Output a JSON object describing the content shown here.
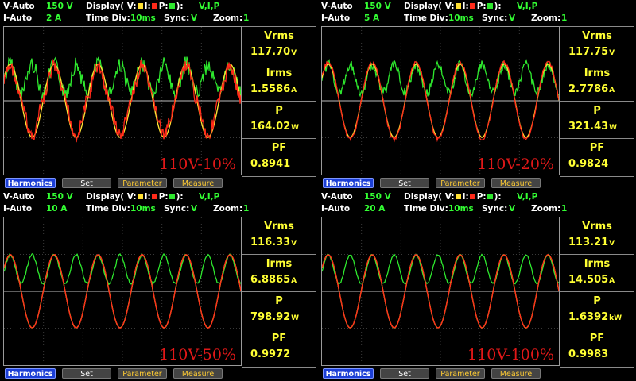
{
  "panels": [
    {
      "v_range_label": "V-Auto",
      "v_range": "150 V",
      "i_range_label": "I-Auto",
      "i_range": "2 A",
      "display_label": "Display( V:",
      "display_i": "I:",
      "display_p": "P:",
      "display_close": "):",
      "display_value": "V,I,P",
      "time_div_label": "Time  Div:",
      "time_div": "10ms",
      "sync_label": "Sync:",
      "sync": "V",
      "zoom_label": "Zoom:",
      "zoom": "1",
      "scenario": "110V-10%",
      "measurements": [
        {
          "label": "Vrms",
          "value": "117.70",
          "unit": "V"
        },
        {
          "label": "Irms",
          "value": "1.5586",
          "unit": "A"
        },
        {
          "label": "P",
          "value": "164.02",
          "unit": "W"
        },
        {
          "label": "PF",
          "value": "0.8941",
          "unit": ""
        }
      ],
      "buttons": {
        "harmonics": "Harmonics",
        "set": "Set",
        "parameter": "Parameter",
        "measure": "Measure"
      }
    },
    {
      "v_range_label": "V-Auto",
      "v_range": "150 V",
      "i_range_label": "I-Auto",
      "i_range": "5 A",
      "display_label": "Display( V:",
      "display_i": "I:",
      "display_p": "P:",
      "display_close": "):",
      "display_value": "V,I,P",
      "time_div_label": "Time  Div:",
      "time_div": "10ms",
      "sync_label": "Sync:",
      "sync": "V",
      "zoom_label": "Zoom:",
      "zoom": "1",
      "scenario": "110V-20%",
      "measurements": [
        {
          "label": "Vrms",
          "value": "117.75",
          "unit": "V"
        },
        {
          "label": "Irms",
          "value": "2.7786",
          "unit": "A"
        },
        {
          "label": "P",
          "value": "321.43",
          "unit": "W"
        },
        {
          "label": "PF",
          "value": "0.9824",
          "unit": ""
        }
      ],
      "buttons": {
        "harmonics": "Harmonics",
        "set": "Set",
        "parameter": "Parameter",
        "measure": "Measure"
      }
    },
    {
      "v_range_label": "V-Auto",
      "v_range": "150 V",
      "i_range_label": "I-Auto",
      "i_range": "10 A",
      "display_label": "Display( V:",
      "display_i": "I:",
      "display_p": "P:",
      "display_close": "):",
      "display_value": "V,I,P",
      "time_div_label": "Time  Div:",
      "time_div": "10ms",
      "sync_label": "Sync:",
      "sync": "V",
      "zoom_label": "Zoom:",
      "zoom": "1",
      "scenario": "110V-50%",
      "measurements": [
        {
          "label": "Vrms",
          "value": "116.33",
          "unit": "V"
        },
        {
          "label": "Irms",
          "value": "6.8865",
          "unit": "A"
        },
        {
          "label": "P",
          "value": "798.92",
          "unit": "W"
        },
        {
          "label": "PF",
          "value": "0.9972",
          "unit": ""
        }
      ],
      "buttons": {
        "harmonics": "Harmonics",
        "set": "Set",
        "parameter": "Parameter",
        "measure": "Measure"
      }
    },
    {
      "v_range_label": "V-Auto",
      "v_range": "150 V",
      "i_range_label": "I-Auto",
      "i_range": "20 A",
      "display_label": "Display( V:",
      "display_i": "I:",
      "display_p": "P:",
      "display_close": "):",
      "display_value": "V,I,P",
      "time_div_label": "Time  Div:",
      "time_div": "10ms",
      "sync_label": "Sync:",
      "sync": "V",
      "zoom_label": "Zoom:",
      "zoom": "1",
      "scenario": "110V-100%",
      "measurements": [
        {
          "label": "Vrms",
          "value": "113.21",
          "unit": "V"
        },
        {
          "label": "Irms",
          "value": "14.505",
          "unit": "A"
        },
        {
          "label": "P",
          "value": "1.6392",
          "unit": "kW"
        },
        {
          "label": "PF",
          "value": "0.9983",
          "unit": ""
        }
      ],
      "buttons": {
        "harmonics": "Harmonics",
        "set": "Set",
        "parameter": "Parameter",
        "measure": "Measure"
      }
    }
  ],
  "colors": {
    "voltage": "#ffe033",
    "current": "#ff2a1a",
    "power": "#2ee82e",
    "accent": "#33ff33",
    "harmonics_button": "#1c3fd6"
  }
}
